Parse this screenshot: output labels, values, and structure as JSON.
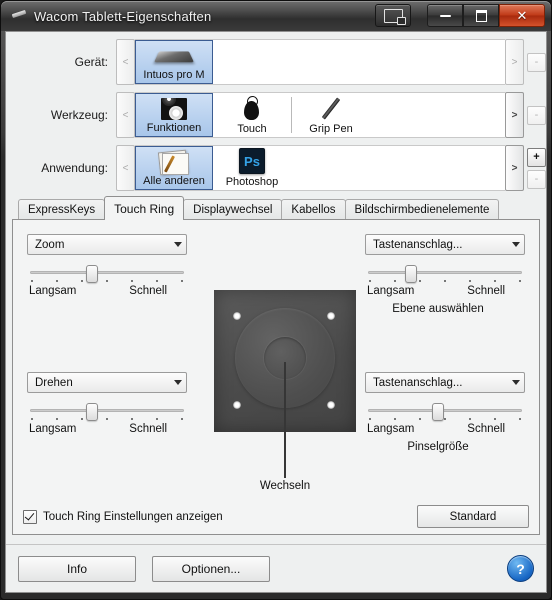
{
  "window": {
    "title": "Wacom Tablett-Eigenschaften",
    "title_icon": "pen-icon",
    "controls": {
      "display_icon": "display-switch-icon",
      "minimize": "minimize-icon",
      "maximize": "maximize-icon",
      "close": "close-icon"
    }
  },
  "selectors": [
    {
      "label": "Gerät:",
      "prev": "<",
      "next": ">",
      "plus": "+",
      "minus": "-",
      "plus_enabled": false,
      "minus_enabled": false,
      "next_enabled": false,
      "items": [
        {
          "caption": "Intuos pro M",
          "icon": "tablet-icon",
          "selected": true
        }
      ]
    },
    {
      "label": "Werkzeug:",
      "prev": "<",
      "next": ">",
      "plus": "+",
      "minus": "-",
      "plus_enabled": false,
      "minus_enabled": false,
      "next_enabled": true,
      "items": [
        {
          "caption": "Funktionen",
          "icon": "functions-icon",
          "selected": true
        },
        {
          "caption": "Touch",
          "icon": "touch-finger-icon",
          "selected": false
        },
        {
          "caption": "Grip Pen",
          "icon": "grip-pen-icon",
          "selected": false
        }
      ]
    },
    {
      "label": "Anwendung:",
      "prev": "<",
      "next": ">",
      "plus": "+",
      "minus": "-",
      "plus_enabled": true,
      "minus_enabled": false,
      "next_enabled": true,
      "items": [
        {
          "caption": "Alle anderen",
          "icon": "all-others-icon",
          "selected": true
        },
        {
          "caption": "Photoshop",
          "icon": "photoshop-icon",
          "selected": false
        }
      ]
    }
  ],
  "tabs": [
    {
      "label": "ExpressKeys",
      "active": false
    },
    {
      "label": "Touch Ring",
      "active": true
    },
    {
      "label": "Displaywechsel",
      "active": false
    },
    {
      "label": "Kabellos",
      "active": false
    },
    {
      "label": "Bildschirmbedienelemente",
      "active": false
    }
  ],
  "controls": {
    "top_left": {
      "name": "touch-ring-function-top-left",
      "value": "Zoom",
      "slider": {
        "position": 40,
        "min_label": "Langsam",
        "max_label": "Schnell",
        "ticks": 7
      },
      "caption": ""
    },
    "top_right": {
      "name": "touch-ring-function-top-right",
      "value": "Tastenanschlag...",
      "slider": {
        "position": 28,
        "min_label": "Langsam",
        "max_label": "Schnell",
        "ticks": 7
      },
      "caption": "Ebene auswählen"
    },
    "bottom_left": {
      "name": "touch-ring-function-bottom-left",
      "value": "Drehen",
      "slider": {
        "position": 40,
        "min_label": "Langsam",
        "max_label": "Schnell",
        "ticks": 7
      },
      "caption": ""
    },
    "bottom_right": {
      "name": "touch-ring-function-bottom-right",
      "value": "Tastenanschlag...",
      "slider": {
        "position": 45,
        "min_label": "Langsam",
        "max_label": "Schnell",
        "ticks": 7
      },
      "caption": "Pinselgröße"
    }
  },
  "diagram": {
    "name": "touch-ring-diagram",
    "callout_label": "Wechseln",
    "led_count": 4
  },
  "panel_footer": {
    "checkbox_label": "Touch Ring Einstellungen anzeigen",
    "checkbox_checked": true,
    "default_button": "Standard"
  },
  "footer": {
    "info_button": "Info",
    "options_button": "Optionen...",
    "help_button": "?"
  },
  "colors": {
    "selection": "#a8c6ea",
    "selection_border": "#3b5c92",
    "panel_bg": "#f3f4f4",
    "close_red": "#c03a18",
    "help_blue": "#1766c4"
  }
}
